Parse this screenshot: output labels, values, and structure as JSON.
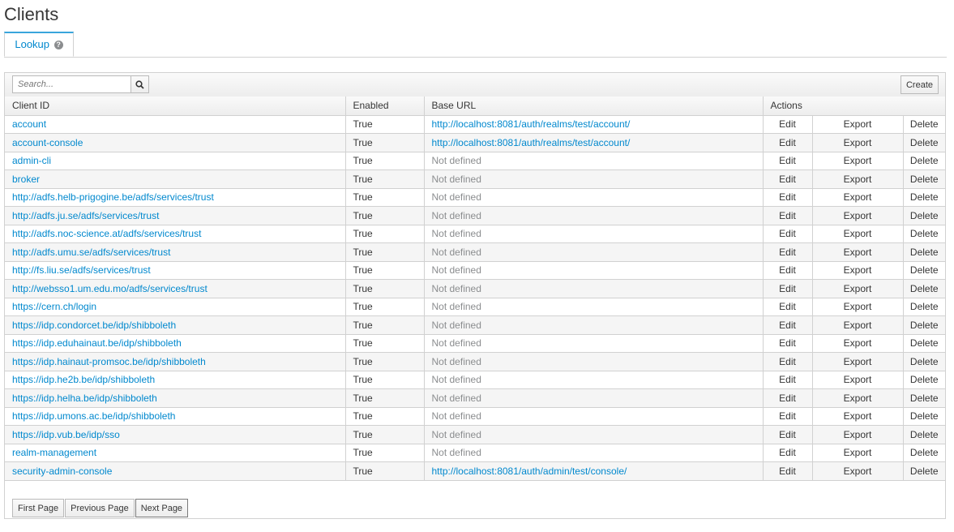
{
  "page_title": "Clients",
  "tabs": [
    {
      "label": "Lookup"
    }
  ],
  "search": {
    "placeholder": "Search..."
  },
  "toolbar": {
    "create_label": "Create"
  },
  "columns": {
    "client_id": "Client ID",
    "enabled": "Enabled",
    "base_url": "Base URL",
    "actions": "Actions"
  },
  "actions": {
    "edit": "Edit",
    "export": "Export",
    "delete": "Delete"
  },
  "rows": [
    {
      "client_id": "account",
      "enabled": "True",
      "base_url": "http://localhost:8081/auth/realms/test/account/",
      "defined": true
    },
    {
      "client_id": "account-console",
      "enabled": "True",
      "base_url": "http://localhost:8081/auth/realms/test/account/",
      "defined": true
    },
    {
      "client_id": "admin-cli",
      "enabled": "True",
      "base_url": "Not defined",
      "defined": false
    },
    {
      "client_id": "broker",
      "enabled": "True",
      "base_url": "Not defined",
      "defined": false
    },
    {
      "client_id": "http://adfs.helb-prigogine.be/adfs/services/trust",
      "enabled": "True",
      "base_url": "Not defined",
      "defined": false
    },
    {
      "client_id": "http://adfs.ju.se/adfs/services/trust",
      "enabled": "True",
      "base_url": "Not defined",
      "defined": false
    },
    {
      "client_id": "http://adfs.noc-science.at/adfs/services/trust",
      "enabled": "True",
      "base_url": "Not defined",
      "defined": false
    },
    {
      "client_id": "http://adfs.umu.se/adfs/services/trust",
      "enabled": "True",
      "base_url": "Not defined",
      "defined": false
    },
    {
      "client_id": "http://fs.liu.se/adfs/services/trust",
      "enabled": "True",
      "base_url": "Not defined",
      "defined": false
    },
    {
      "client_id": "http://websso1.um.edu.mo/adfs/services/trust",
      "enabled": "True",
      "base_url": "Not defined",
      "defined": false
    },
    {
      "client_id": "https://cern.ch/login",
      "enabled": "True",
      "base_url": "Not defined",
      "defined": false
    },
    {
      "client_id": "https://idp.condorcet.be/idp/shibboleth",
      "enabled": "True",
      "base_url": "Not defined",
      "defined": false
    },
    {
      "client_id": "https://idp.eduhainaut.be/idp/shibboleth",
      "enabled": "True",
      "base_url": "Not defined",
      "defined": false
    },
    {
      "client_id": "https://idp.hainaut-promsoc.be/idp/shibboleth",
      "enabled": "True",
      "base_url": "Not defined",
      "defined": false
    },
    {
      "client_id": "https://idp.he2b.be/idp/shibboleth",
      "enabled": "True",
      "base_url": "Not defined",
      "defined": false
    },
    {
      "client_id": "https://idp.helha.be/idp/shibboleth",
      "enabled": "True",
      "base_url": "Not defined",
      "defined": false
    },
    {
      "client_id": "https://idp.umons.ac.be/idp/shibboleth",
      "enabled": "True",
      "base_url": "Not defined",
      "defined": false
    },
    {
      "client_id": "https://idp.vub.be/idp/sso",
      "enabled": "True",
      "base_url": "Not defined",
      "defined": false
    },
    {
      "client_id": "realm-management",
      "enabled": "True",
      "base_url": "Not defined",
      "defined": false
    },
    {
      "client_id": "security-admin-console",
      "enabled": "True",
      "base_url": "http://localhost:8081/auth/admin/test/console/",
      "defined": true
    }
  ],
  "pagination": {
    "first": "First Page",
    "previous": "Previous Page",
    "next": "Next Page"
  },
  "icons": {
    "search": "search-icon",
    "help": "help-icon"
  },
  "colors": {
    "link": "#0088ce",
    "tab_accent": "#39a5dc",
    "muted": "#8b8d8f"
  }
}
